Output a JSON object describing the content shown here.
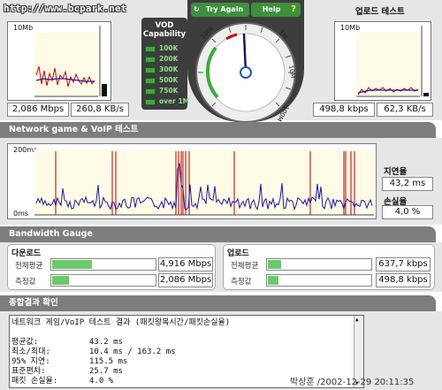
{
  "site": "http://www.bcpark.net",
  "download": {
    "graph_max": "10Mb",
    "speed": "2,086 Mbps",
    "rate": "260,8 KB/s"
  },
  "vod": {
    "title_line1": "VOD",
    "title_line2": "Capability",
    "levels": [
      "100K",
      "200K",
      "300K",
      "500K",
      "750K",
      "over 1M"
    ]
  },
  "gauge": {
    "try_again": "Try Again",
    "help": "Help",
    "help_icon": "?",
    "refresh_icon": "refresh-icon",
    "scale_labels": [
      "100k",
      "1M",
      "10M",
      "100M"
    ]
  },
  "upload": {
    "title": "업로드 테스트",
    "graph_max": "10Mb",
    "speed": "498,8 kbps",
    "rate": "62,3 KB/s"
  },
  "network": {
    "title": "Network game & VoIP 테스트",
    "y_top": "200ms",
    "y_bottom": "0ms",
    "latency_label": "지연율",
    "latency_value": "43,2 ms",
    "loss_label": "손실율",
    "loss_value": "4,0 %"
  },
  "bandwidth": {
    "title": "Bandwidth Gauge",
    "download_title": "다운로드",
    "upload_title": "업로드",
    "avg_label": "전체평균",
    "measured_label": "측정값",
    "down_avg": "4,916 Mbps",
    "down_measured": "2,086 Mbps",
    "up_avg": "637,7 kbps",
    "up_measured": "498,8 kbps",
    "down_avg_fill": 0.38,
    "down_measured_fill": 0.16,
    "up_avg_fill": 0.13,
    "up_measured_fill": 0.1
  },
  "results": {
    "title": "종합결과 확인",
    "header_line": "네트워크 게임/VoIP 테스트 결과 (패킷왕복시간/패킷손실율)",
    "rows": [
      {
        "label": "평균값:",
        "value": "43.2 ms"
      },
      {
        "label": "최소/최대:",
        "value": "10.4 ms / 163.2 ms"
      },
      {
        "label": "95% 지연:",
        "value": "115.5 ms"
      },
      {
        "label": "표준편차:",
        "value": "25.7 ms"
      },
      {
        "label": "패킷 손실율:",
        "value": "4.0 %"
      }
    ]
  },
  "footer": "박상훈 /2002-12-29 20:11:35",
  "colors": {
    "panel": "#e6e6e6",
    "header": "#7d7d7d",
    "gauge_bg": "#3d3d3d",
    "accent_green": "#3caa3c",
    "latency_line": "#1a1aa8",
    "loss_line": "#b00000"
  }
}
